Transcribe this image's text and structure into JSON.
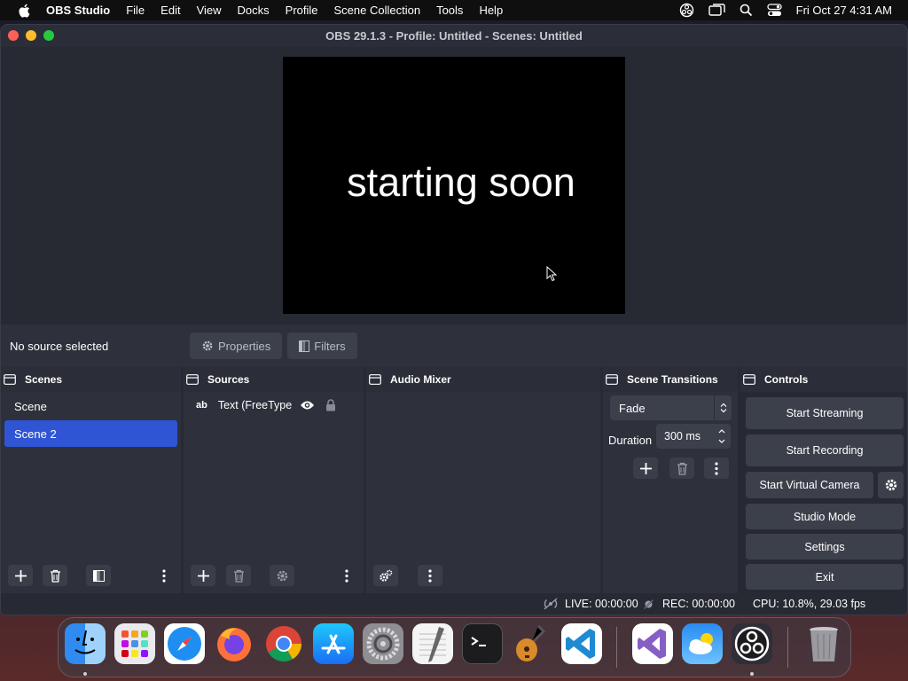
{
  "menubar": {
    "app_name": "OBS Studio",
    "items": [
      "File",
      "Edit",
      "View",
      "Docks",
      "Profile",
      "Scene Collection",
      "Tools",
      "Help"
    ],
    "clock": "Fri Oct 27  4:31 AM"
  },
  "window": {
    "title": "OBS 29.1.3 - Profile: Untitled - Scenes: Untitled"
  },
  "preview": {
    "text": "starting soon"
  },
  "source_bar": {
    "status": "No source selected",
    "properties_label": "Properties",
    "filters_label": "Filters"
  },
  "docks": {
    "scenes": {
      "title": "Scenes",
      "items": [
        "Scene",
        "Scene 2"
      ],
      "selected": "Scene 2"
    },
    "sources": {
      "title": "Sources",
      "items": [
        {
          "type_glyph": "ab",
          "label": "Text (FreeType"
        }
      ]
    },
    "audio_mixer": {
      "title": "Audio Mixer"
    },
    "transitions": {
      "title": "Scene Transitions",
      "selected": "Fade",
      "duration_label": "Duration",
      "duration_value": "300 ms"
    },
    "controls": {
      "title": "Controls",
      "start_streaming": "Start Streaming",
      "start_recording": "Start Recording",
      "start_virtual_camera": "Start Virtual Camera",
      "studio_mode": "Studio Mode",
      "settings": "Settings",
      "exit": "Exit"
    }
  },
  "status": {
    "live": "LIVE: 00:00:00",
    "rec": "REC: 00:00:00",
    "cpu": "CPU: 10.8%, 29.03 fps"
  },
  "dock_apps": [
    "finder-icon",
    "launchpad-icon",
    "safari-icon",
    "firefox-icon",
    "chrome-icon",
    "app-store-icon",
    "system-settings-icon",
    "textedit-icon",
    "terminal-icon",
    "garageband-icon",
    "vscode-icon",
    "visual-studio-icon",
    "weather-icon",
    "obs-icon",
    "trash-icon"
  ],
  "colors": {
    "accent": "#2f55d4",
    "panel": "#2e313b",
    "button": "#3c404b"
  }
}
